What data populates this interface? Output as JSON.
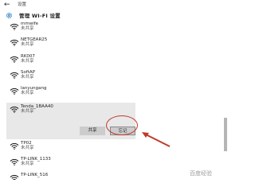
{
  "window": {
    "back_glyph": "←",
    "title": "设置"
  },
  "header": {
    "icon": "gear-icon",
    "title": "管理 WI-FI 设置"
  },
  "networks": [
    {
      "ssid": "mmwife",
      "status": "未共享"
    },
    {
      "ssid": "NETGEAR25",
      "status": "未共享"
    },
    {
      "ssid": "RK007",
      "status": "未共享"
    },
    {
      "ssid": "SoftAP",
      "status": "未共享"
    },
    {
      "ssid": "lanyungang",
      "status": "未共享"
    },
    {
      "ssid": "Tenda_1BAA40",
      "status": "未共享"
    },
    {
      "ssid": "TP02",
      "status": "未共享"
    },
    {
      "ssid": "TP-LINK_1133",
      "status": "未共享"
    },
    {
      "ssid": "TP-LINK_516",
      "status": ""
    }
  ],
  "selected_actions": {
    "share_label": "共享",
    "forget_label": "忘记"
  },
  "watermark": "百度经验",
  "colors": {
    "selected_bg": "#e8e8e8",
    "button_bg": "#cccccc",
    "annotation": "#c0392b",
    "scrollbar_thumb": "#b5b5b5"
  }
}
